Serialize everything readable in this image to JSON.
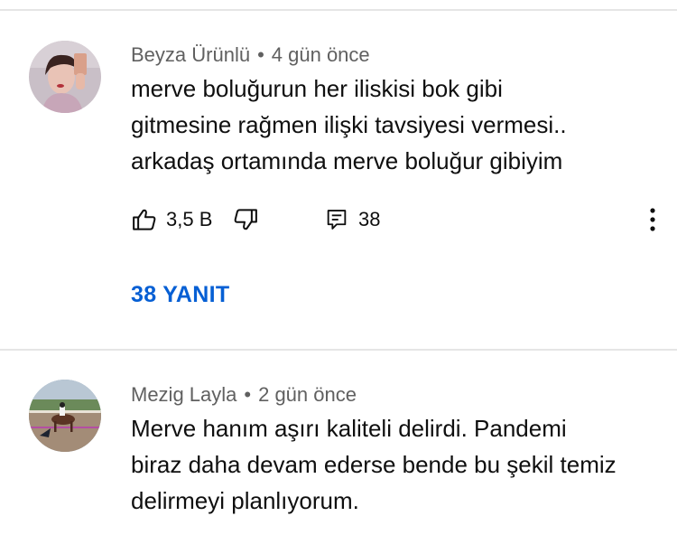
{
  "comments": [
    {
      "author": "Beyza Ürünlü",
      "time": "4 gün önce",
      "lines": [
        "merve boluğurun her iliskisi bok gibi",
        "gitmesine rağmen ilişki tavsiyesi vermesi..",
        "arkadaş ortamında merve boluğur gibiyim"
      ],
      "likes": "3,5 B",
      "reply_count": "38",
      "replies_label": "38 YANIT"
    },
    {
      "author": "Mezig Layla",
      "time": "2 gün önce",
      "lines": [
        "Merve hanım aşırı kaliteli delirdi. Pandemi",
        "biraz daha devam ederse bende bu şekil temiz",
        "delirmeyi planlıyorum."
      ]
    }
  ],
  "separator": "•",
  "colors": {
    "link": "#065fd4",
    "meta": "#606060",
    "divider": "#e5e5e5"
  },
  "icons": [
    "like-icon",
    "dislike-icon",
    "reply-icon",
    "more-vert-icon"
  ]
}
